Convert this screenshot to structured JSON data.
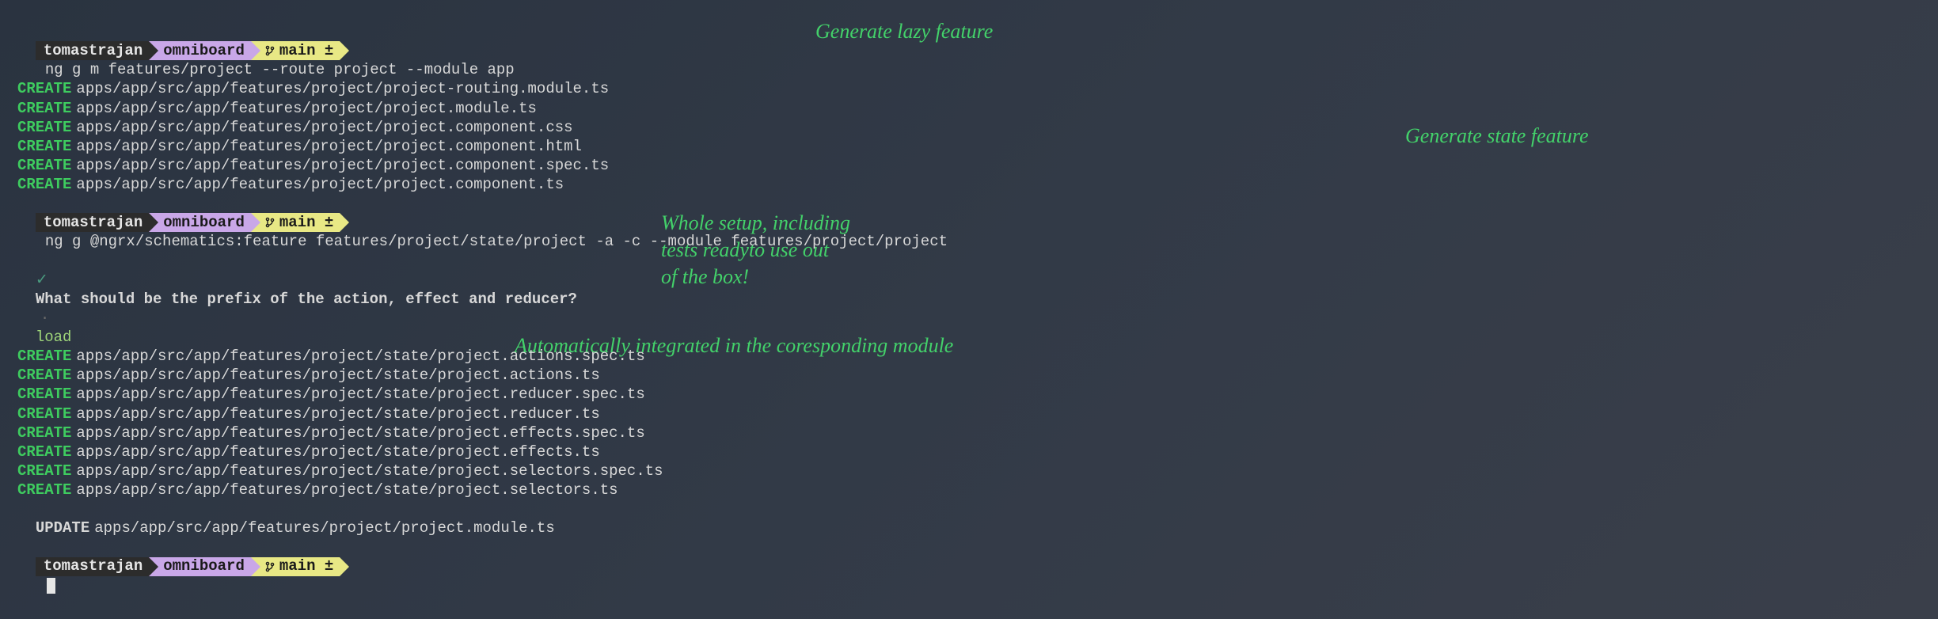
{
  "prompt": {
    "user": "tomastrajan",
    "project": "omniboard",
    "branch": "main ±"
  },
  "commands": {
    "c1": "ng g m features/project --route project --module app",
    "c2": "ng g @ngrx/schematics:feature features/project/state/project -a -c --module features/project/project",
    "c3": ""
  },
  "files1": [
    "apps/app/src/app/features/project/project-routing.module.ts",
    "apps/app/src/app/features/project/project.module.ts",
    "apps/app/src/app/features/project/project.component.css",
    "apps/app/src/app/features/project/project.component.html",
    "apps/app/src/app/features/project/project.component.spec.ts",
    "apps/app/src/app/features/project/project.component.ts"
  ],
  "question": {
    "text": "What should be the prefix of the action, effect and reducer?",
    "answer": "load"
  },
  "files2": [
    "apps/app/src/app/features/project/state/project.actions.spec.ts",
    "apps/app/src/app/features/project/state/project.actions.ts",
    "apps/app/src/app/features/project/state/project.reducer.spec.ts",
    "apps/app/src/app/features/project/state/project.reducer.ts",
    "apps/app/src/app/features/project/state/project.effects.spec.ts",
    "apps/app/src/app/features/project/state/project.effects.ts",
    "apps/app/src/app/features/project/state/project.selectors.spec.ts",
    "apps/app/src/app/features/project/state/project.selectors.ts"
  ],
  "update_file": "apps/app/src/app/features/project/project.module.ts",
  "labels": {
    "create": "CREATE",
    "update": "UPDATE"
  },
  "annotations": {
    "a1": "Generate lazy feature",
    "a2": "Generate state feature",
    "a3": "Whole setup, including\ntests readyto use out\nof the box!",
    "a4": "Automatically integrated in the coresponding module"
  }
}
